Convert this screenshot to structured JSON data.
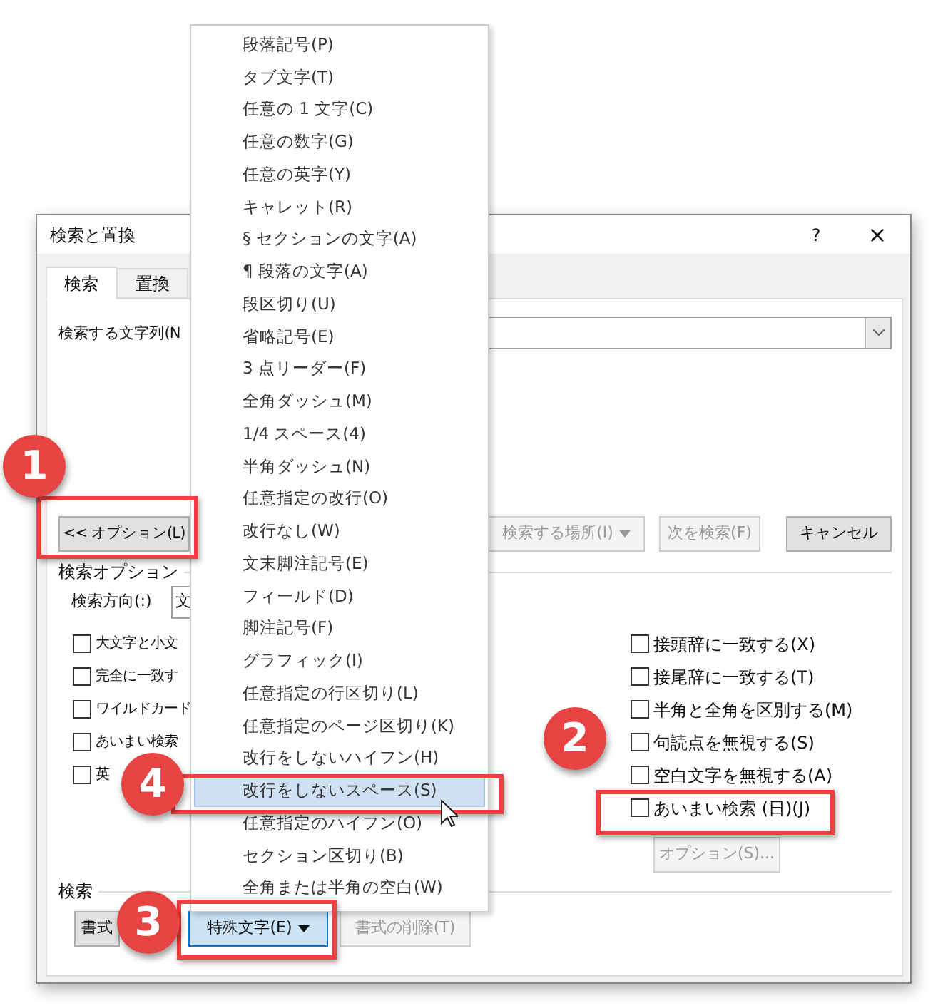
{
  "dialog": {
    "title": "検索と置換",
    "help": "?",
    "close": "×",
    "tabs": [
      {
        "label": "検索",
        "selected": true
      },
      {
        "label": "置換",
        "selected": false
      }
    ],
    "find_label": "検索する文字列(N",
    "options_button": "<< オプション(L)",
    "action_buttons": [
      {
        "label": "検索する場所(I)",
        "dropdown": true,
        "disabled": true
      },
      {
        "label": "次を検索(F)",
        "dropdown": false,
        "disabled": true
      },
      {
        "label": "キャンセル",
        "dropdown": false,
        "disabled": false
      }
    ],
    "options_group": "検索オプション",
    "direction_label": "検索方向(:)",
    "direction_value": "文",
    "left_options": [
      {
        "label": "大文字と小文",
        "checked": false
      },
      {
        "label": "完全に一致す",
        "checked": false
      },
      {
        "label": "ワイルドカード",
        "checked": false
      },
      {
        "label": "あいまい検索",
        "checked": false
      },
      {
        "label": "英",
        "checked": false
      }
    ],
    "right_options": [
      {
        "label": "接頭辞に一致する(X)",
        "checked": false
      },
      {
        "label": "接尾辞に一致する(T)",
        "checked": false
      },
      {
        "label": "半角と全角を区別する(M)",
        "checked": false
      },
      {
        "label": "句読点を無視する(S)",
        "checked": false
      },
      {
        "label": "空白文字を無視する(A)",
        "checked": false
      },
      {
        "label": "あいまい検索 (日)(J)",
        "checked": false
      }
    ],
    "fuzzy_options_button": {
      "label": "オプション(S)...",
      "disabled": true
    },
    "format_group": "検索",
    "bottom_buttons": [
      {
        "label": "書式",
        "dropdown": false,
        "disabled": false,
        "selected": false
      },
      {
        "label": "特殊文字(E)",
        "dropdown": true,
        "disabled": false,
        "selected": true
      },
      {
        "label": "書式の削除(T)",
        "dropdown": false,
        "disabled": true,
        "selected": false
      }
    ]
  },
  "menu": {
    "items": [
      {
        "label": "段落記号(P)",
        "selected": false
      },
      {
        "label": "タブ文字(T)",
        "selected": false
      },
      {
        "label": "任意の 1 文字(C)",
        "selected": false
      },
      {
        "label": "任意の数字(G)",
        "selected": false
      },
      {
        "label": "任意の英字(Y)",
        "selected": false
      },
      {
        "label": "キャレット(R)",
        "selected": false
      },
      {
        "label": "§ セクションの文字(A)",
        "selected": false
      },
      {
        "label": "¶ 段落の文字(A)",
        "selected": false
      },
      {
        "label": "段区切り(U)",
        "selected": false
      },
      {
        "label": "省略記号(E)",
        "selected": false
      },
      {
        "label": "3 点リーダー(F)",
        "selected": false
      },
      {
        "label": "全角ダッシュ(M)",
        "selected": false
      },
      {
        "label": "1/4 スペース(4)",
        "selected": false
      },
      {
        "label": "半角ダッシュ(N)",
        "selected": false
      },
      {
        "label": "任意指定の改行(O)",
        "selected": false
      },
      {
        "label": "改行なし(W)",
        "selected": false
      },
      {
        "label": "文末脚注記号(E)",
        "selected": false
      },
      {
        "label": "フィールド(D)",
        "selected": false
      },
      {
        "label": "脚注記号(F)",
        "selected": false
      },
      {
        "label": "グラフィック(I)",
        "selected": false
      },
      {
        "label": "任意指定の行区切り(L)",
        "selected": false
      },
      {
        "label": "任意指定のページ区切り(K)",
        "selected": false
      },
      {
        "label": "改行をしないハイフン(H)",
        "selected": false
      },
      {
        "label": "改行をしないスペース(S)",
        "selected": true
      },
      {
        "label": "任意指定のハイフン(O)",
        "selected": false
      },
      {
        "label": "セクション区切り(B)",
        "selected": false
      },
      {
        "label": "全角または半角の空白(W)",
        "selected": false
      }
    ]
  },
  "annotations": [
    {
      "number": "1"
    },
    {
      "number": "2"
    },
    {
      "number": "3"
    },
    {
      "number": "4"
    }
  ]
}
